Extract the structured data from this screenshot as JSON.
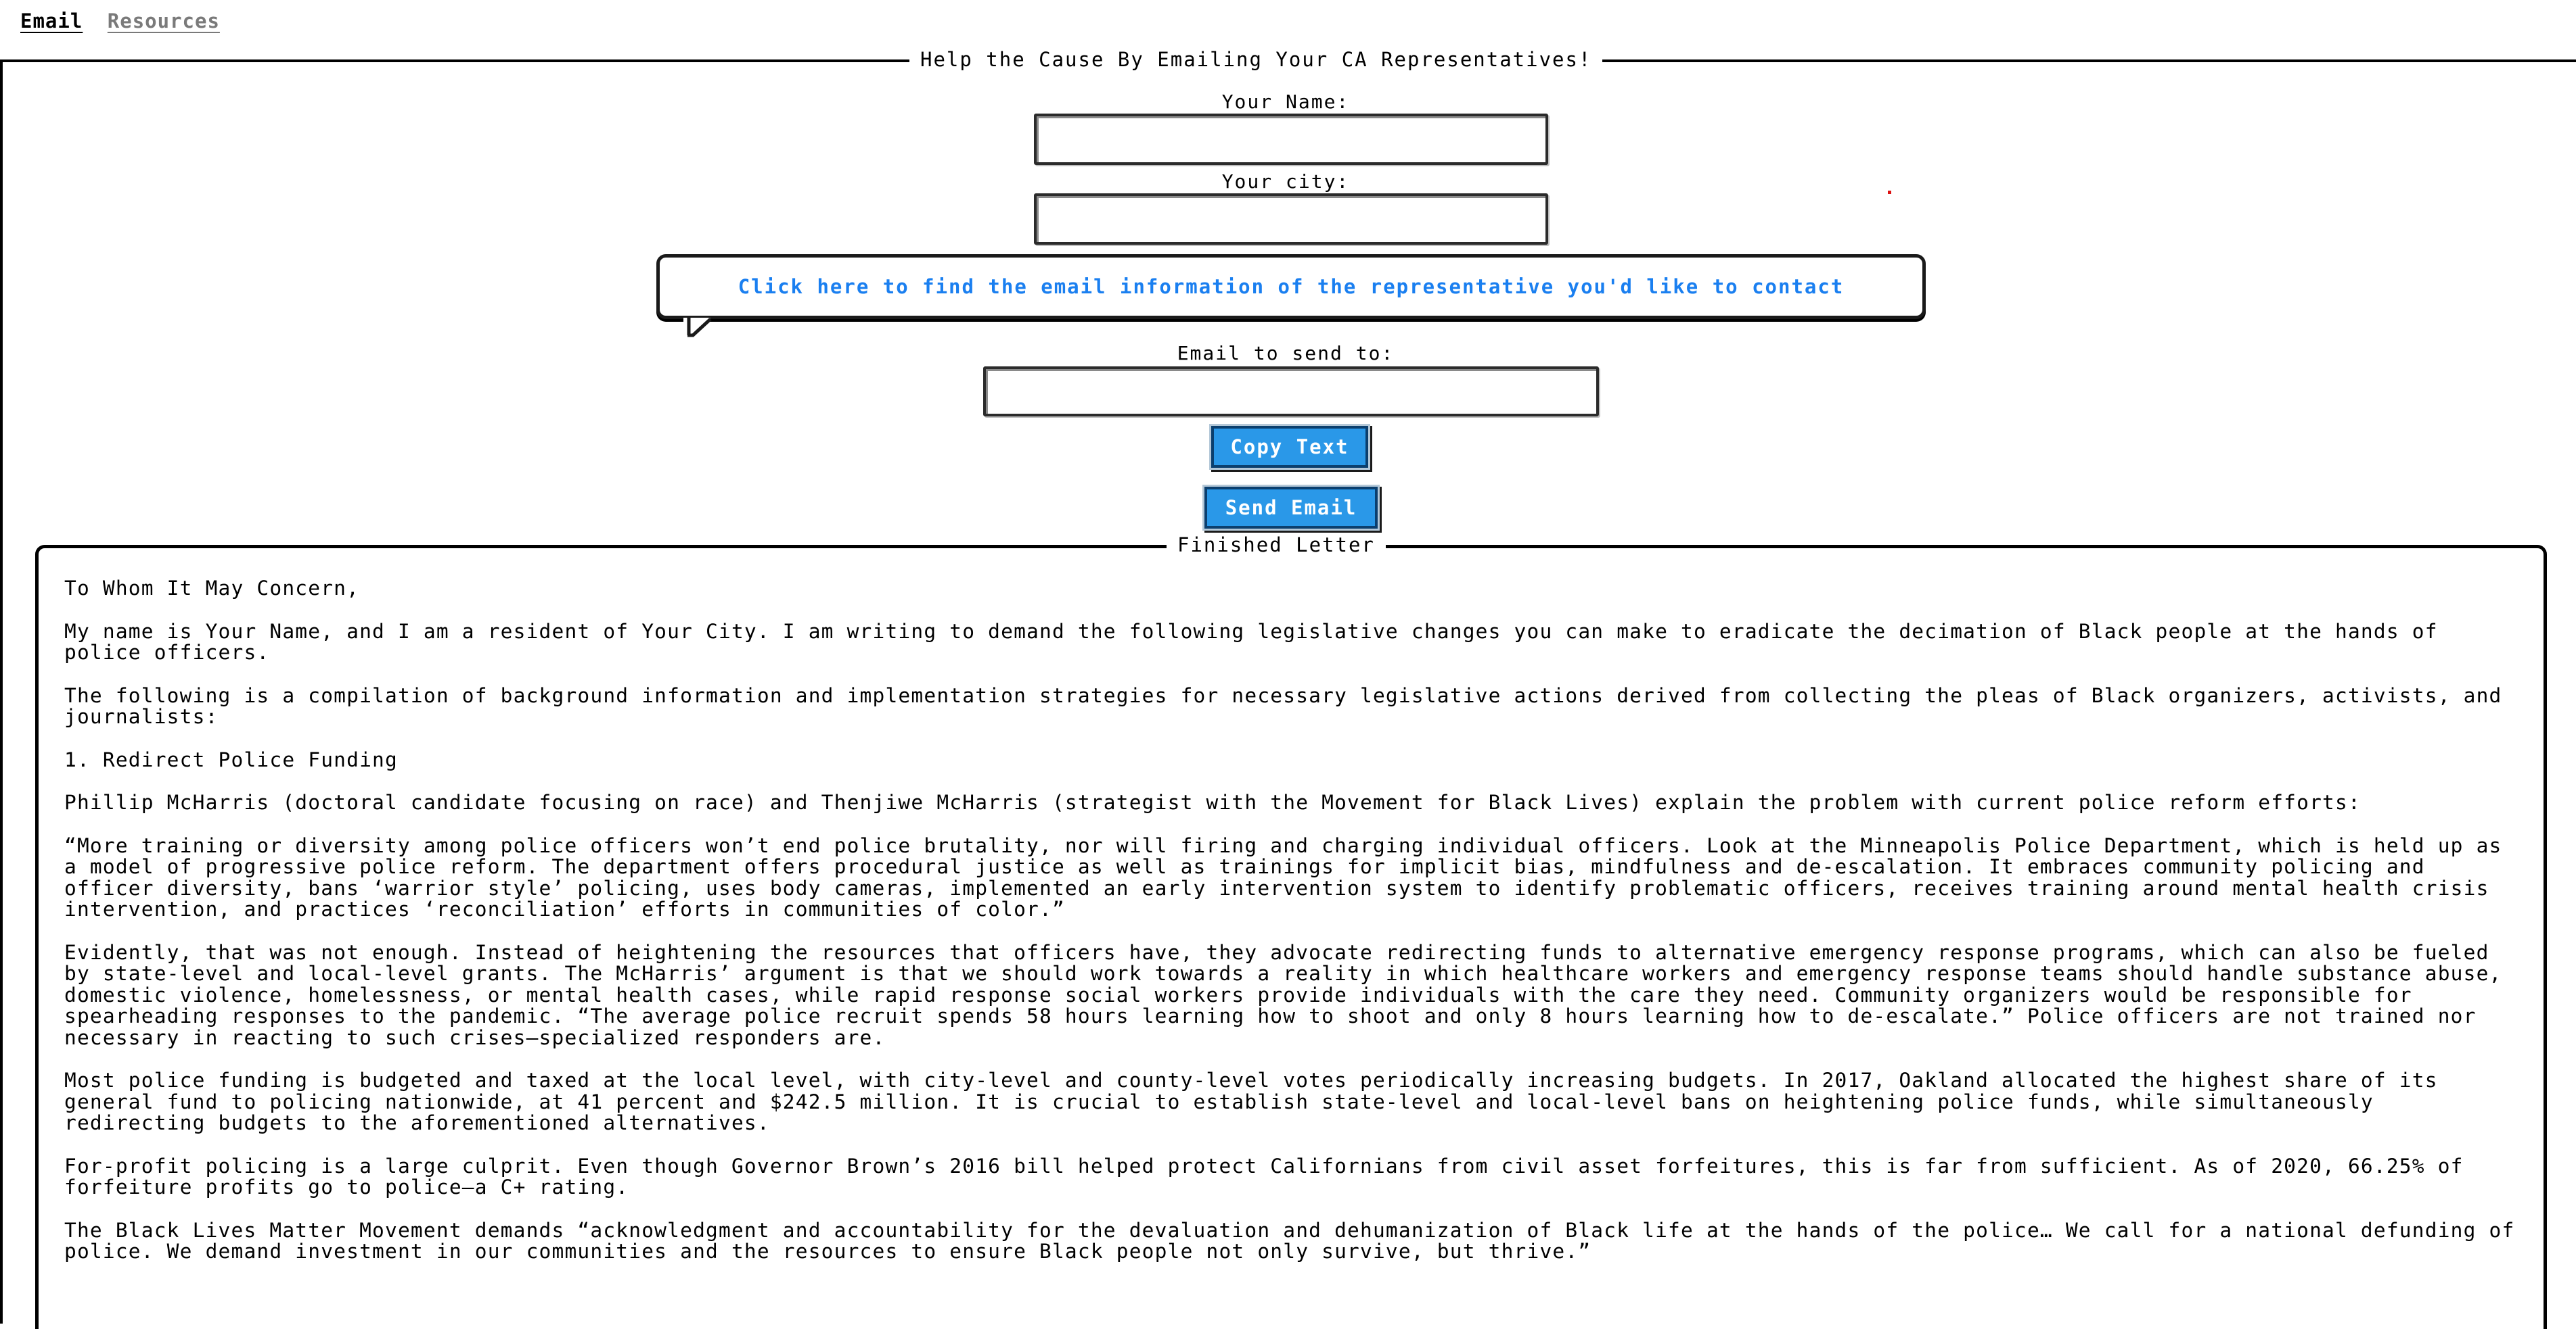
{
  "nav": {
    "email": "Email",
    "resources": "Resources"
  },
  "form": {
    "legend": "Help the Cause By Emailing Your CA Representatives!",
    "name_label": "Your Name:",
    "name_value": "",
    "city_label": "Your city:",
    "city_value": "",
    "rep_link": "Click here to find the email information of the representative you'd like to contact",
    "email_label": "Email to send to:",
    "email_value": "",
    "copy_button": "Copy Text",
    "send_button": "Send Email"
  },
  "letter": {
    "legend": "Finished Letter",
    "paragraphs": [
      "To Whom It May Concern,",
      "My name is Your Name, and I am a resident of Your City. I am writing to demand the following legislative changes you can make to eradicate the decimation of Black people at the hands of police officers.",
      "The following is a compilation of background information and implementation strategies for necessary legislative actions derived from collecting the pleas of Black organizers, activists, and journalists:",
      "1. Redirect Police Funding",
      "Phillip McHarris (doctoral candidate focusing on race) and Thenjiwe McHarris (strategist with the Movement for Black Lives) explain the problem with current police reform efforts:",
      "“More training or diversity among police officers won’t end police brutality, nor will firing and charging individual officers. Look at the Minneapolis Police Department, which is held up as a model of progressive police reform. The department offers procedural justice as well as trainings for implicit bias, mindfulness and de-escalation. It embraces community policing and officer diversity, bans ‘warrior style’ policing, uses body cameras, implemented an early intervention system to identify problematic officers, receives training around mental health crisis intervention, and practices ‘reconciliation’ efforts in communities of color.”",
      "Evidently, that was not enough. Instead of heightening the resources that officers have, they advocate redirecting funds to alternative emergency response programs, which can also be fueled by state-level and local-level grants. The McHarris’ argument is that we should work towards a reality in which healthcare workers and emergency response teams should handle substance abuse, domestic violence, homelessness, or mental health cases, while rapid response social workers provide individuals with the care they need. Community organizers would be responsible for spearheading responses to the pandemic. “The average police recruit spends 58 hours learning how to shoot and only 8 hours learning how to de-escalate.” Police officers are not trained nor necessary in reacting to such crises—specialized responders are.",
      "Most police funding is budgeted and taxed at the local level, with city-level and county-level votes periodically increasing budgets. In 2017, Oakland allocated the highest share of its general fund to policing nationwide, at 41 percent and $242.5 million. It is crucial to establish state-level and local-level bans on heightening police funds, while simultaneously redirecting budgets to the aforementioned alternatives.",
      "For-profit policing is a large culprit. Even though Governor Brown’s 2016 bill helped protect Californians from civil asset forfeitures, this is far from sufficient. As of 2020, 66.25% of forfeiture profits go to police—a C+ rating.",
      "The Black Lives Matter Movement demands “acknowledgment and accountability for the devaluation and dehumanization of Black life at the hands of the police… We call for a national defunding of police. We demand investment in our communities and the resources to ensure Black people not only survive, but thrive.”"
    ]
  }
}
